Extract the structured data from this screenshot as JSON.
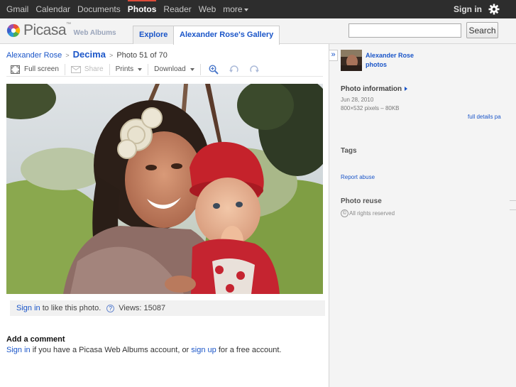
{
  "topnav": {
    "links": [
      "Gmail",
      "Calendar",
      "Documents",
      "Photos",
      "Reader",
      "Web",
      "more"
    ],
    "signin": "Sign in"
  },
  "header": {
    "logo_word": "Picasa",
    "logo_tm": "™",
    "logo_sub": "Web Albums",
    "tabs": [
      "Explore",
      "Alexander Rose's Gallery"
    ],
    "search_value": "",
    "search_button": "Search"
  },
  "breadcrumb": {
    "owner": "Alexander Rose",
    "separator": ">",
    "album": "Decima",
    "position": "Photo 51 of 70"
  },
  "toolbar": {
    "fullscreen": "Full screen",
    "share": "Share",
    "prints": "Prints",
    "download": "Download"
  },
  "likes": {
    "signin": "Sign in",
    "text": " to like this photo.",
    "help": "?",
    "views": "Views: 15087"
  },
  "comment": {
    "title": "Add a comment",
    "signin": "Sign in",
    "middle": " if you have a Picasa Web Albums account, or ",
    "signup": "sign up",
    "end": " for a free account."
  },
  "sidebar": {
    "collapse": "»",
    "owner_name": "Alexander Rose",
    "owner_photos": "photos",
    "info_heading": "Photo information",
    "date": "Jun 28, 2010",
    "dimensions": "800×532 pixels – 80KB",
    "full_details": "full details pa",
    "tags_heading": "Tags",
    "report": "Report abuse",
    "reuse_heading": "Photo reuse",
    "copyright_symbol": "©",
    "rights": "All rights reserved"
  },
  "colors": {
    "topbar": "#2d2d2d",
    "active_tab_indicator": "#dd4b39",
    "link": "#1a55c8"
  }
}
